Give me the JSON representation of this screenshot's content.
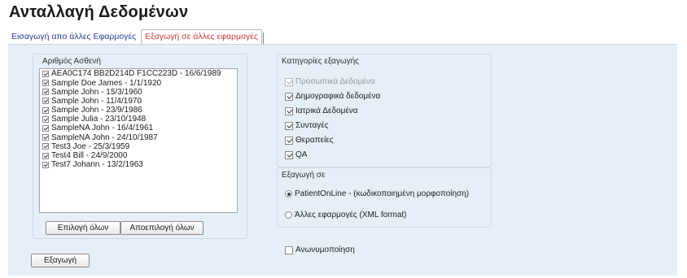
{
  "title": "Ανταλλαγή Δεδομένων",
  "tabs": [
    {
      "label": "Εισαγωγή απο άλλες Εφαρμογές",
      "active": false
    },
    {
      "label": "Εξαγωγή σε άλλες εφαρμογές",
      "active": true
    }
  ],
  "patients": {
    "label": "Αριθμός Ασθενή",
    "items": [
      {
        "label": "AEA0C174 BB2D214D F1CC223D - 16/6/1989",
        "checked": true
      },
      {
        "label": "Sample Doe James - 1/1/1920",
        "checked": true
      },
      {
        "label": "Sample John - 15/3/1960",
        "checked": true
      },
      {
        "label": "Sample John - 11/4/1970",
        "checked": true
      },
      {
        "label": "Sample John - 23/9/1986",
        "checked": true
      },
      {
        "label": "Sample Julia - 23/10/1948",
        "checked": true
      },
      {
        "label": "SampleNA John - 16/4/1961",
        "checked": true
      },
      {
        "label": "SampleNA John - 24/10/1987",
        "checked": true
      },
      {
        "label": "Test3 Joe - 25/3/1959",
        "checked": true
      },
      {
        "label": "Test4 Bill - 24/9/2000",
        "checked": true
      },
      {
        "label": "Test7 Johann - 13/2/1963",
        "checked": true
      }
    ],
    "select_all_label": "Επιλογή όλων",
    "deselect_all_label": "Αποεπιλογή όλων"
  },
  "export_button_label": "Εξαγωγή",
  "categories": {
    "label": "Κατηγορίες εξαγωγής",
    "items": [
      {
        "label": "Προσωπικά Δεδομένα",
        "checked": true,
        "disabled": true
      },
      {
        "label": "Δημογραφικά δεδομένα",
        "checked": true,
        "disabled": false
      },
      {
        "label": "Ιατρικά Δεδομένα",
        "checked": true,
        "disabled": false
      },
      {
        "label": "Συνταγές",
        "checked": true,
        "disabled": false
      },
      {
        "label": "Θεραπείες",
        "checked": true,
        "disabled": false
      },
      {
        "label": "QA",
        "checked": true,
        "disabled": false
      }
    ]
  },
  "export_to": {
    "label": "Εξαγωγή σε",
    "options": [
      {
        "label": "PatientOnLine - (κωδικοποιημένη μορφοποίηση)",
        "selected": true
      },
      {
        "label": "Άλλες εφαρμογές (XML format)",
        "selected": false
      }
    ]
  },
  "anonymize": {
    "label": "Ανωνυμοποίηση",
    "checked": false
  }
}
